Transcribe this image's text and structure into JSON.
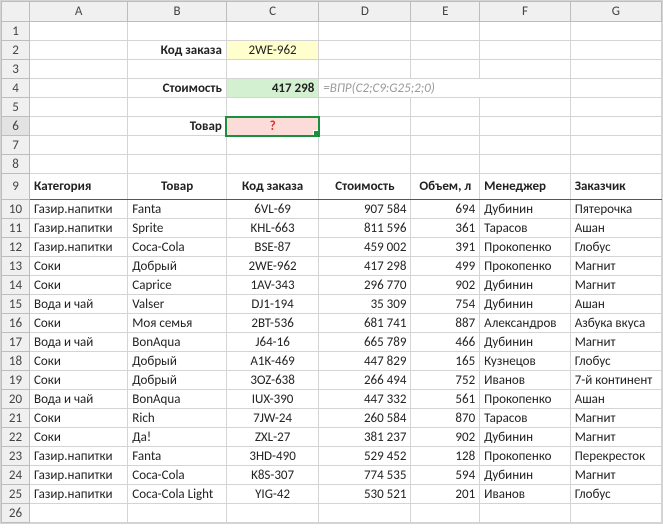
{
  "columns": [
    "A",
    "B",
    "C",
    "D",
    "E",
    "F",
    "G"
  ],
  "form": {
    "row2": {
      "label": "Код заказа",
      "value": "2WE-962"
    },
    "row4": {
      "label": "Стоимость",
      "value": "417 298",
      "formula": "=ВПР(С2;С9:G25;2;0)"
    },
    "row6": {
      "label": "Товар",
      "value": "?"
    }
  },
  "headers": {
    "cat": "Категория",
    "prod": "Товар",
    "code": "Код заказа",
    "cost": "Стоимость",
    "vol": "Объем, л",
    "mgr": "Менеджер",
    "cust": "Заказчик"
  },
  "rows": [
    {
      "n": 10,
      "cat": "Газир.напитки",
      "prod": "Fanta",
      "code": "6VL-69",
      "cost": "907 584",
      "vol": "694",
      "mgr": "Дубинин",
      "cust": "Пятерочка"
    },
    {
      "n": 11,
      "cat": "Газир.напитки",
      "prod": "Sprite",
      "code": "KHL-663",
      "cost": "811 596",
      "vol": "361",
      "mgr": "Тарасов",
      "cust": "Ашан"
    },
    {
      "n": 12,
      "cat": "Газир.напитки",
      "prod": "Coca-Cola",
      "code": "BSE-87",
      "cost": "459 002",
      "vol": "391",
      "mgr": "Прокопенко",
      "cust": "Глобус"
    },
    {
      "n": 13,
      "cat": "Соки",
      "prod": "Добрый",
      "code": "2WE-962",
      "cost": "417 298",
      "vol": "499",
      "mgr": "Прокопенко",
      "cust": "Магнит"
    },
    {
      "n": 14,
      "cat": "Соки",
      "prod": "Caprice",
      "code": "1AV-343",
      "cost": "296 770",
      "vol": "902",
      "mgr": "Дубинин",
      "cust": "Магнит"
    },
    {
      "n": 15,
      "cat": "Вода и чай",
      "prod": "Valser",
      "code": "DJ1-194",
      "cost": "35 309",
      "vol": "754",
      "mgr": "Дубинин",
      "cust": "Ашан"
    },
    {
      "n": 16,
      "cat": "Соки",
      "prod": "Моя семья",
      "code": "2BT-536",
      "cost": "681 741",
      "vol": "887",
      "mgr": "Александров",
      "cust": "Азбука вкуса"
    },
    {
      "n": 17,
      "cat": "Вода и чай",
      "prod": "BonAqua",
      "code": "J64-16",
      "cost": "665 789",
      "vol": "466",
      "mgr": "Дубинин",
      "cust": "Магнит"
    },
    {
      "n": 18,
      "cat": "Соки",
      "prod": "Добрый",
      "code": "A1K-469",
      "cost": "447 829",
      "vol": "165",
      "mgr": "Кузнецов",
      "cust": "Глобус"
    },
    {
      "n": 19,
      "cat": "Соки",
      "prod": "Добрый",
      "code": "3OZ-638",
      "cost": "266 494",
      "vol": "752",
      "mgr": "Иванов",
      "cust": "7-й континент"
    },
    {
      "n": 20,
      "cat": "Вода и чай",
      "prod": "BonAqua",
      "code": "IUX-390",
      "cost": "447 332",
      "vol": "561",
      "mgr": "Прокопенко",
      "cust": "Ашан"
    },
    {
      "n": 21,
      "cat": "Соки",
      "prod": "Rich",
      "code": "7JW-24",
      "cost": "260 584",
      "vol": "870",
      "mgr": "Тарасов",
      "cust": "Магнит"
    },
    {
      "n": 22,
      "cat": "Соки",
      "prod": "Да!",
      "code": "ZXL-27",
      "cost": "381 237",
      "vol": "902",
      "mgr": "Дубинин",
      "cust": "Магнит"
    },
    {
      "n": 23,
      "cat": "Газир.напитки",
      "prod": "Fanta",
      "code": "3HD-490",
      "cost": "529 452",
      "vol": "128",
      "mgr": "Прокопенко",
      "cust": "Перекресток"
    },
    {
      "n": 24,
      "cat": "Газир.напитки",
      "prod": "Coca-Cola",
      "code": "K8S-307",
      "cost": "774 535",
      "vol": "594",
      "mgr": "Дубинин",
      "cust": "Магнит"
    },
    {
      "n": 25,
      "cat": "Газир.напитки",
      "prod": "Coca-Cola Light",
      "code": "YIG-42",
      "cost": "530 521",
      "vol": "201",
      "mgr": "Иванов",
      "cust": "Глобус"
    }
  ]
}
